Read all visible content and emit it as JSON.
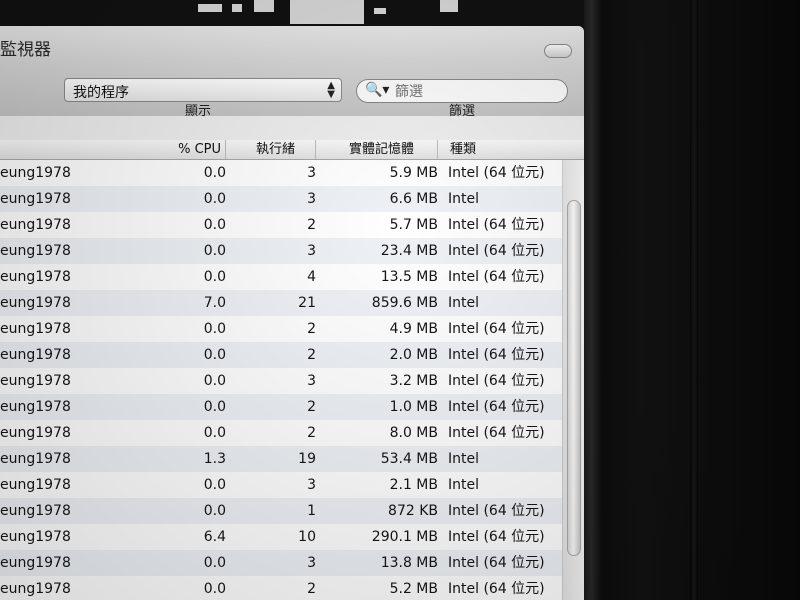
{
  "window": {
    "title": "監視器"
  },
  "toolbar": {
    "process_filter_value": "我的程序",
    "search_placeholder": "篩選",
    "label_show": "顯示",
    "label_filter": "篩選"
  },
  "table": {
    "columns": [
      "% CPU",
      "執行緒",
      "實體記憶體",
      "種類"
    ],
    "rows": [
      [
        "eung1978",
        "0.0",
        "3",
        "5.9 MB",
        "Intel (64 位元)"
      ],
      [
        "eung1978",
        "0.0",
        "3",
        "6.6 MB",
        "Intel"
      ],
      [
        "eung1978",
        "0.0",
        "2",
        "5.7 MB",
        "Intel (64 位元)"
      ],
      [
        "eung1978",
        "0.0",
        "3",
        "23.4 MB",
        "Intel (64 位元)"
      ],
      [
        "eung1978",
        "0.0",
        "4",
        "13.5 MB",
        "Intel (64 位元)"
      ],
      [
        "eung1978",
        "7.0",
        "21",
        "859.6 MB",
        "Intel"
      ],
      [
        "eung1978",
        "0.0",
        "2",
        "4.9 MB",
        "Intel (64 位元)"
      ],
      [
        "eung1978",
        "0.0",
        "2",
        "2.0 MB",
        "Intel (64 位元)"
      ],
      [
        "eung1978",
        "0.0",
        "3",
        "3.2 MB",
        "Intel (64 位元)"
      ],
      [
        "eung1978",
        "0.0",
        "2",
        "1.0 MB",
        "Intel (64 位元)"
      ],
      [
        "eung1978",
        "0.0",
        "2",
        "8.0 MB",
        "Intel (64 位元)"
      ],
      [
        "eung1978",
        "1.3",
        "19",
        "53.4 MB",
        "Intel"
      ],
      [
        "eung1978",
        "0.0",
        "3",
        "2.1 MB",
        "Intel"
      ],
      [
        "eung1978",
        "0.0",
        "1",
        "872 KB",
        "Intel (64 位元)"
      ],
      [
        "eung1978",
        "6.4",
        "10",
        "290.1 MB",
        "Intel (64 位元)"
      ],
      [
        "eung1978",
        "0.0",
        "3",
        "13.8 MB",
        "Intel (64 位元)"
      ],
      [
        "eung1978",
        "0.0",
        "2",
        "5.2 MB",
        "Intel (64 位元)"
      ]
    ]
  },
  "icons": {
    "search": "search-icon",
    "popup_arrows": "popup-arrows-icon",
    "zoom": "zoom-pill-icon"
  },
  "colors": {
    "window_bg": "#eeeeee",
    "row_alt": "#eef2f7",
    "text": "#151515"
  }
}
